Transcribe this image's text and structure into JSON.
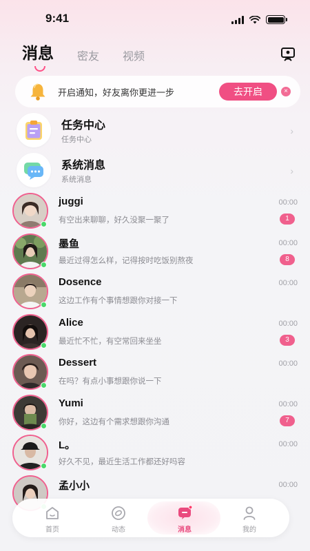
{
  "status": {
    "time": "9:41"
  },
  "tabs": [
    {
      "label": "消息",
      "active": true
    },
    {
      "label": "密友",
      "active": false
    },
    {
      "label": "视频",
      "active": false
    }
  ],
  "notify": {
    "text": "开启通知，好友离你更进一步",
    "button": "去开启",
    "close": "×"
  },
  "system_rows": [
    {
      "title": "任务中心",
      "sub": "任务中心",
      "icon": "task-clipboard-icon"
    },
    {
      "title": "系统消息",
      "sub": "系统消息",
      "icon": "chat-bubble-icon"
    }
  ],
  "chevron": "›",
  "chats": [
    {
      "name": "juggi",
      "msg": "有空出来聊聊，好久没聚一聚了",
      "time": "00:00",
      "unread": "1"
    },
    {
      "name": "墨鱼",
      "msg": "最近过得怎么样，记得按时吃饭别熬夜",
      "time": "00:00",
      "unread": "8"
    },
    {
      "name": "Dosence",
      "msg": "这边工作有个事情想跟你对接一下",
      "time": "00:00",
      "unread": ""
    },
    {
      "name": "Alice",
      "msg": "最近忙不忙，有空常回来坐坐",
      "time": "00:00",
      "unread": "3"
    },
    {
      "name": "Dessert",
      "msg": "在吗？有点小事想跟你说一下",
      "time": "00:00",
      "unread": ""
    },
    {
      "name": "Yumi",
      "msg": "你好，这边有个需求想跟你沟通",
      "time": "00:00",
      "unread": "7"
    },
    {
      "name": "L。",
      "msg": "好久不见，最近生活工作都还好吗容",
      "time": "00:00",
      "unread": ""
    },
    {
      "name": "孟小小",
      "msg": "",
      "time": "00:00",
      "unread": ""
    }
  ],
  "nav": [
    {
      "label": "首页",
      "icon": "home-icon",
      "active": false
    },
    {
      "label": "动态",
      "icon": "moments-icon",
      "active": false
    },
    {
      "label": "消息",
      "icon": "message-icon",
      "active": true
    },
    {
      "label": "我的",
      "icon": "profile-icon",
      "active": false
    }
  ],
  "colors": {
    "accent": "#f04f83",
    "online": "#49d86a"
  }
}
